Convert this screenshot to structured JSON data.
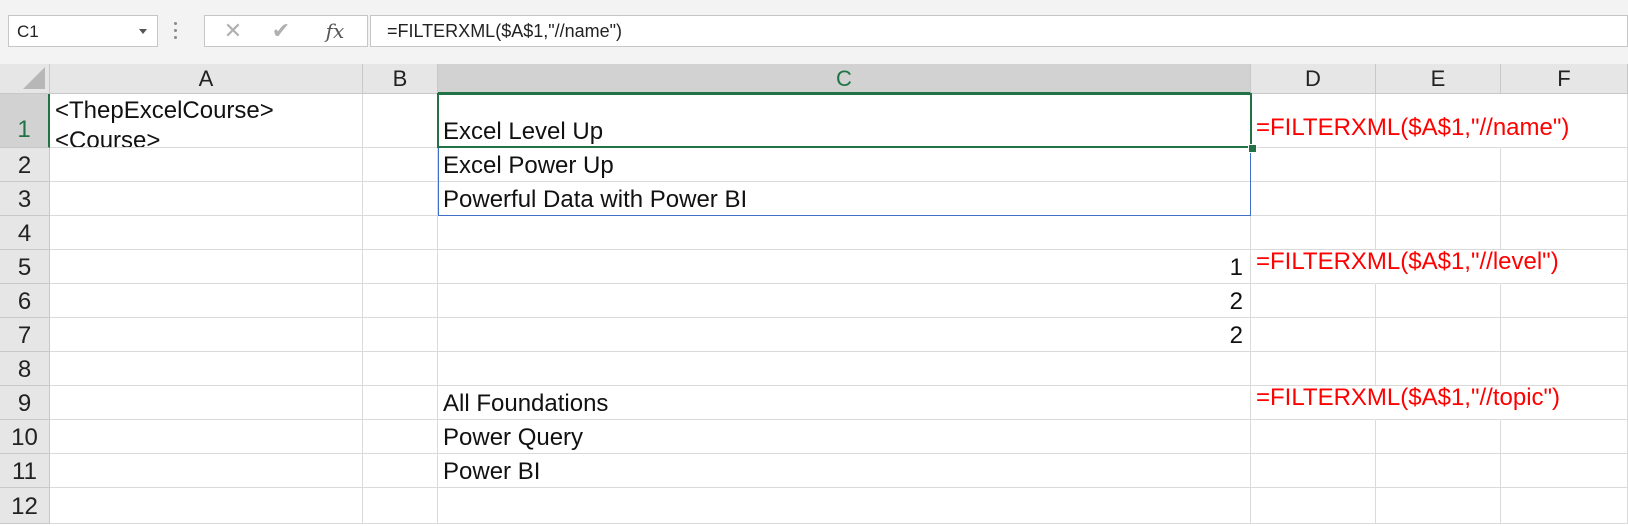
{
  "name_box": {
    "value": "C1"
  },
  "formula_bar": {
    "cancel_symbol": "✕",
    "enter_symbol": "✔",
    "fx_symbol": "fx",
    "formula": "=FILTERXML($A$1,\"//name\")"
  },
  "columns": [
    "A",
    "B",
    "C",
    "D",
    "E",
    "F"
  ],
  "rows": [
    "1",
    "2",
    "3",
    "4",
    "5",
    "6",
    "7",
    "8",
    "9",
    "10",
    "11",
    "12"
  ],
  "cells": {
    "A1_line1": "<ThepExcelCourse>",
    "A1_line2": "<Course>",
    "C1": "Excel Level Up",
    "C2": "Excel Power Up",
    "C3": "Powerful Data with Power BI",
    "C5": "1",
    "C6": "2",
    "C7": "2",
    "C9": "All Foundations",
    "C10": "Power Query",
    "C11": "Power BI",
    "D1": "=FILTERXML($A$1,\"//name\")",
    "D5": "=FILTERXML($A$1,\"//level\")",
    "D9": "=FILTERXML($A$1,\"//topic\")"
  },
  "colors": {
    "selection_green": "#217346",
    "spill_blue": "#3e6fc9",
    "annotation_red": "#ff0000"
  }
}
